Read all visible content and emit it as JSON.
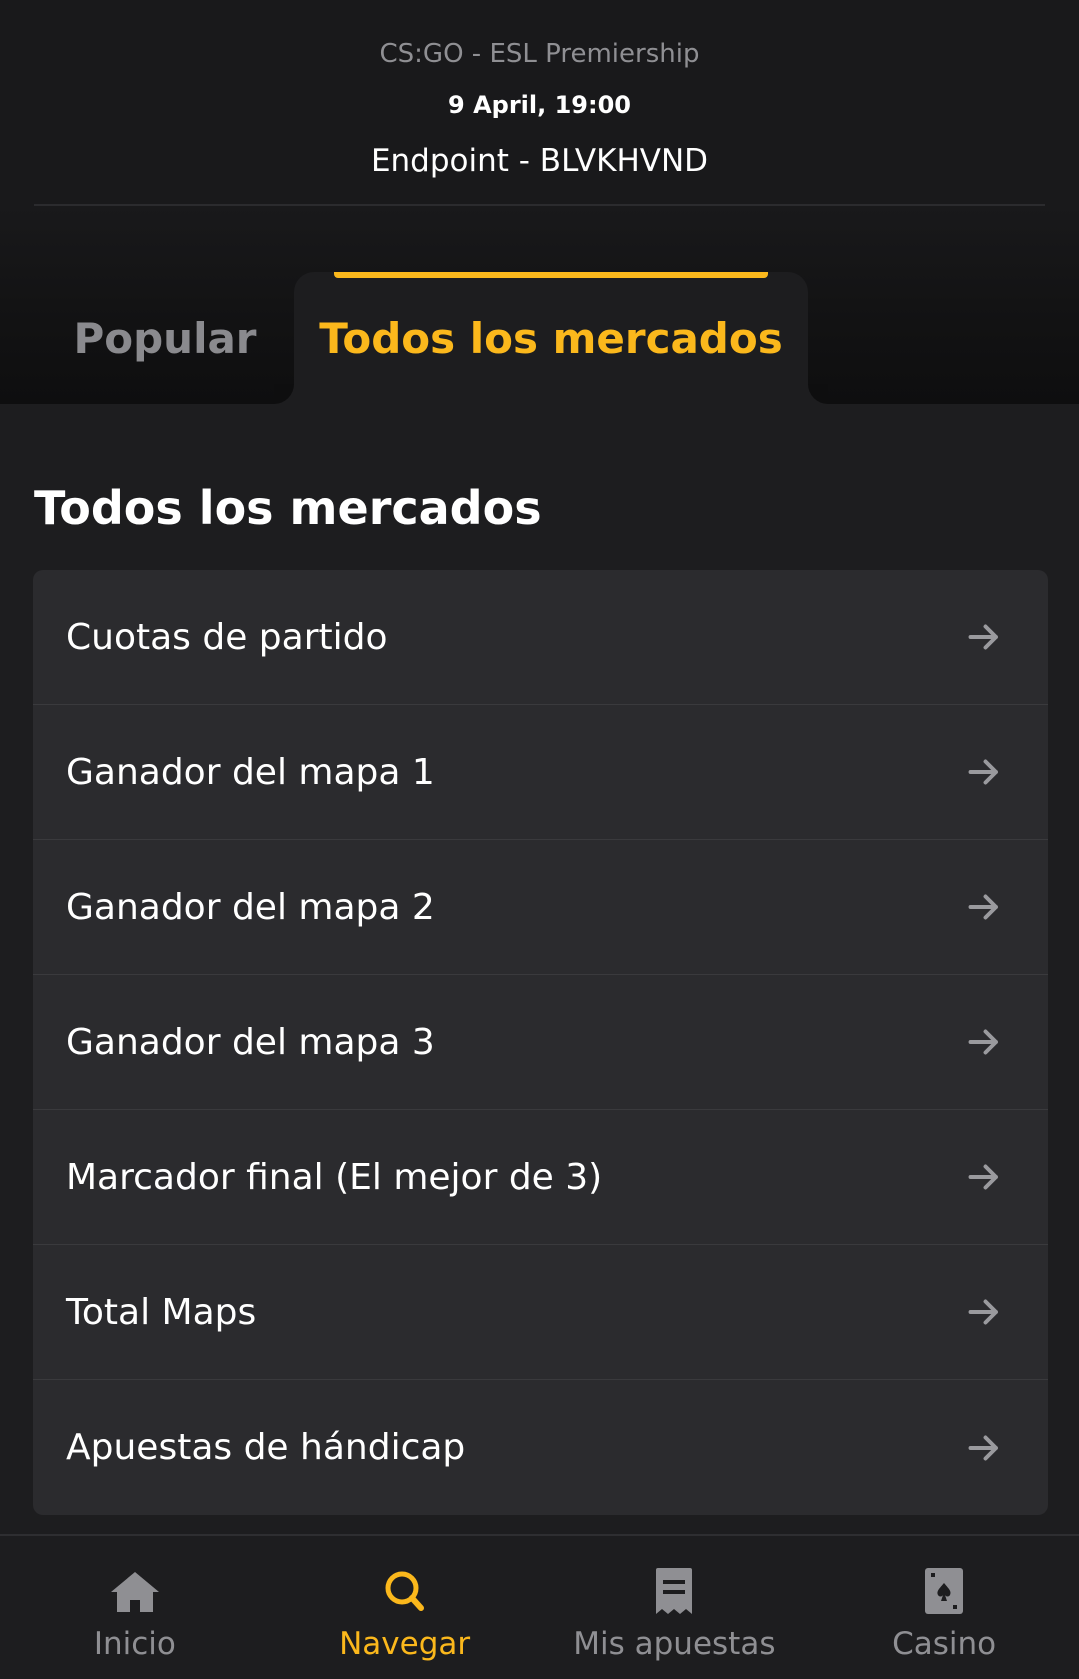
{
  "header": {
    "competition": "CS:GO - ESL Premiership",
    "datetime": "9 April, 19:00",
    "teams": "Endpoint - BLVKHVND"
  },
  "tabs": [
    {
      "label": "Popular",
      "active": false
    },
    {
      "label": "Todos los mercados",
      "active": true
    }
  ],
  "section": {
    "title": "Todos los mercados"
  },
  "markets": [
    {
      "label": "Cuotas de partido",
      "icon": "arrow-right-icon"
    },
    {
      "label": "Ganador del mapa 1",
      "icon": "arrow-right-icon"
    },
    {
      "label": "Ganador del mapa 2",
      "icon": "arrow-right-icon"
    },
    {
      "label": "Ganador del mapa 3",
      "icon": "arrow-right-icon"
    },
    {
      "label": "Marcador final (El mejor de 3)",
      "icon": "arrow-right-icon"
    },
    {
      "label": "Total Maps",
      "icon": "arrow-right-icon"
    },
    {
      "label": "Apuestas de hándicap",
      "icon": "arrow-right-icon"
    }
  ],
  "bottom_nav": [
    {
      "label": "Inicio",
      "icon": "home-icon",
      "active": false
    },
    {
      "label": "Navegar",
      "icon": "search-icon",
      "active": true
    },
    {
      "label": "Mis apuestas",
      "icon": "bet-slip-icon",
      "active": false
    },
    {
      "label": "Casino",
      "icon": "playing-card-icon",
      "active": false
    }
  ],
  "colors": {
    "accent": "#fbb81c",
    "background": "#1d1d1f",
    "card": "#2b2b2e",
    "muted_text": "#8f8f93"
  }
}
